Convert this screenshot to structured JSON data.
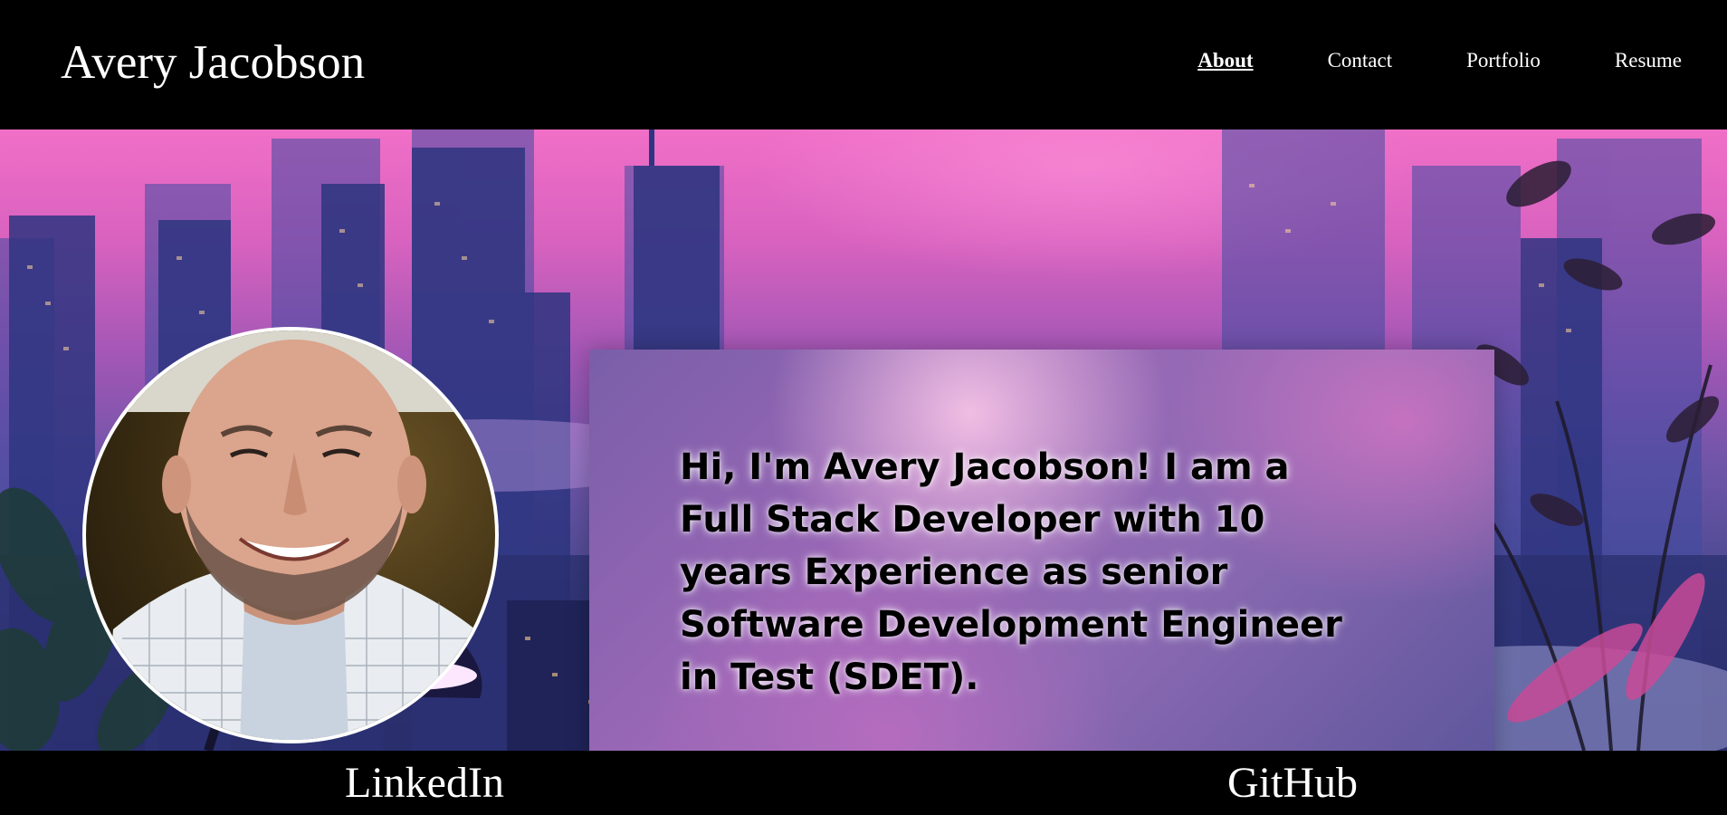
{
  "header": {
    "brand": "Avery Jacobson",
    "nav": [
      {
        "label": "About",
        "active": true
      },
      {
        "label": "Contact",
        "active": false
      },
      {
        "label": "Portfolio",
        "active": false
      },
      {
        "label": "Resume",
        "active": false
      }
    ]
  },
  "hero": {
    "avatar_alt": "Portrait photo of Avery Jacobson",
    "intro": "Hi, I'm Avery Jacobson! I am a Full Stack Developer with 10 years Experience as senior Software Development Engineer in Test (SDET)."
  },
  "footer": {
    "links": [
      "LinkedIn",
      "GitHub"
    ]
  },
  "colors": {
    "header_bg": "#000000",
    "text_light": "#ffffff",
    "sky_pink": "#f06fc7",
    "sky_violet": "#6f55a8",
    "city_dark": "#2a2c66"
  }
}
